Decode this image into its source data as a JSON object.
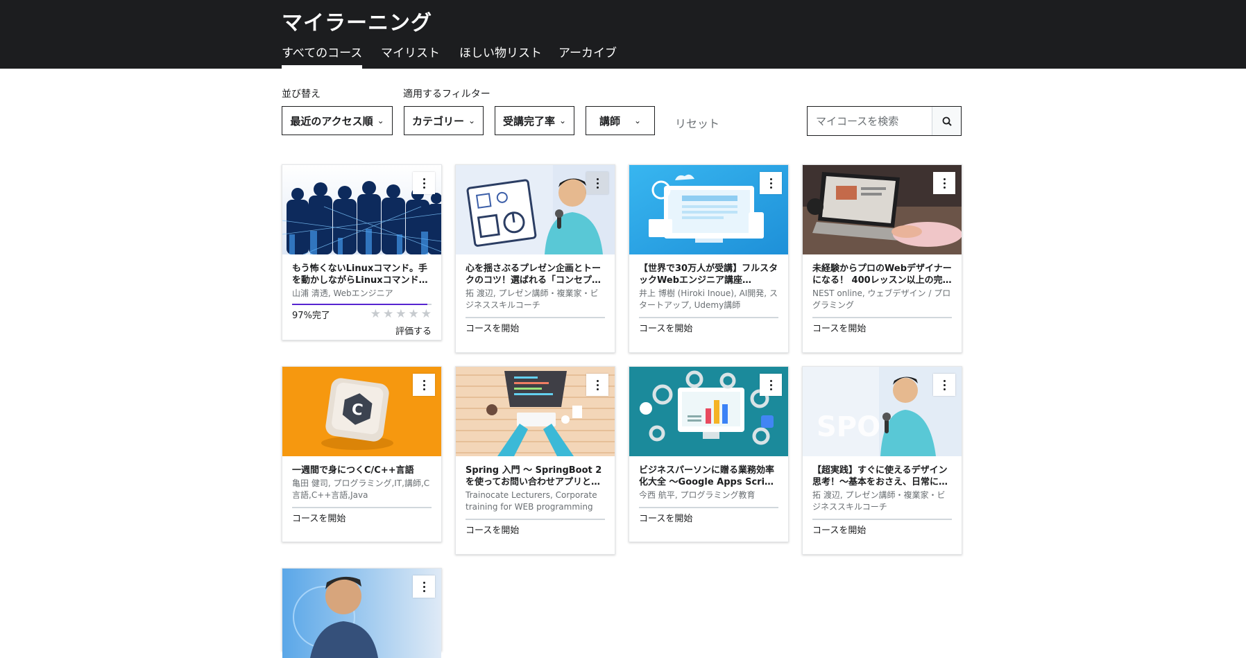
{
  "header": {
    "title": "マイラーニング",
    "tabs": [
      {
        "label": "すべてのコース",
        "active": true
      },
      {
        "label": "マイリスト"
      },
      {
        "label": "ほしい物リスト"
      },
      {
        "label": "アーカイブ"
      }
    ]
  },
  "filters": {
    "sort_label": "並び替え",
    "filter_label": "適用するフィルター",
    "sort_value": "最近のアクセス順",
    "category": "カテゴリー",
    "completion": "受講完了率",
    "instructor": "講師",
    "reset": "リセット",
    "search_placeholder": "マイコースを検索"
  },
  "courses": [
    {
      "title": "もう怖くないLinuxコマンド。手を動かしながらLinuxコマンド…",
      "instructor": "山浦 清透, Webエンジニア",
      "progress_percent": 97,
      "status": "97%完了",
      "rate_label": "評価する"
    },
    {
      "title": "心を揺さぶるプレゼン企画とトークのコツ！選ばれる「コンセプ…",
      "instructor": "拓 渡辺, プレゼン講師・複業家・ビジネススキルコーチ",
      "status": "コースを開始"
    },
    {
      "title": "【世界で30万人が受講】フルスタックWebエンジニア講座（2019…",
      "instructor": "井上 博樹 (Hiroki Inoue), AI開発, スタートアップ, Udemy講師",
      "status": "コースを開始"
    },
    {
      "title": "未経験からプロのWebデザイナーになる！ 400レッスン以上の完…",
      "instructor": "NEST online, ウェブデザイン / プログラミング",
      "status": "コースを開始"
    },
    {
      "title": "一週間で身につくC/C++言語",
      "instructor": "亀田 健司, プログラミング,IT,講師,C言語,C++言語,Java",
      "status": "コースを開始"
    },
    {
      "title": "Spring 入門 〜 SpringBoot 2 を使ってお問い合わせアプリと…",
      "instructor": "Trainocate Lecturers, Corporate training for WEB programming",
      "status": "コースを開始"
    },
    {
      "title": "ビジネスパーソンに贈る業務効率化大全 〜Google Apps Scriptに…",
      "instructor": "今西 航平, プログラミング教育",
      "status": "コースを開始"
    },
    {
      "title": "【超実践】すぐに使えるデザイン思考！〜基本をおさえ、日常に…",
      "instructor": "拓 渡辺, プレゼン講師・複業家・ビジネススキルコーチ",
      "status": "コースを開始"
    },
    {
      "title": "",
      "instructor": "",
      "status": ""
    }
  ]
}
